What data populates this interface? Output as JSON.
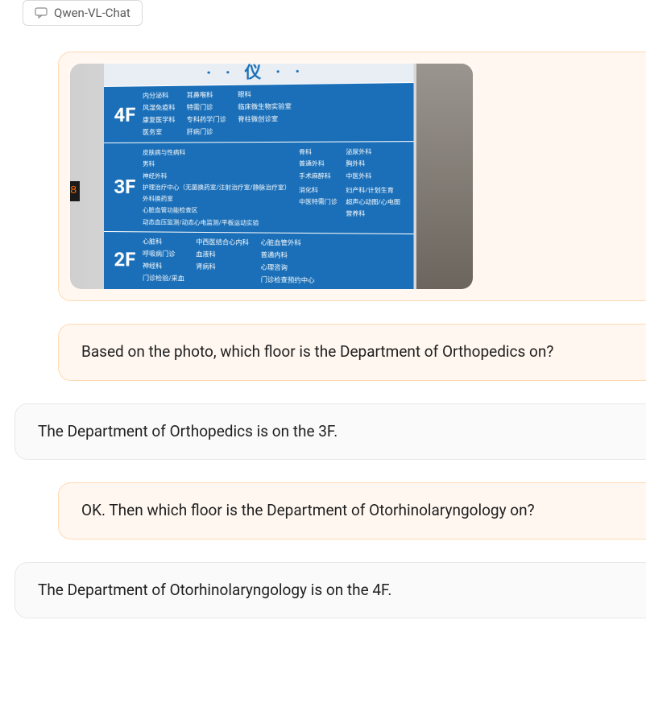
{
  "badge": {
    "label": "Qwen-VL-Chat"
  },
  "messages": {
    "user1": "Based on the photo, which floor is the Department of Orthopedics on?",
    "assistant1": "The Department of Orthopedics is on the 3F.",
    "user2": "OK. Then which floor is the Department of Otorhinolaryngology on?",
    "assistant2": "The Department of Otorhinolaryngology is on the 4F."
  },
  "sign": {
    "elevator_number": "8",
    "floors": {
      "f4": {
        "label": "4F",
        "col1": [
          "内分泌科",
          "风湿免疫科",
          "康复医学科",
          "医务室"
        ],
        "col2": [
          "耳鼻喉科",
          "特需门诊",
          "专科药学门诊",
          "肝病门诊"
        ],
        "col3": [
          "眼科",
          "临床微生物实验室",
          "脊柱微创诊室"
        ]
      },
      "f3": {
        "label": "3F",
        "col1": [
          "皮肤病与性病科",
          "男科",
          "神经外科",
          "护理治疗中心（无菌换药室/注射治疗室/静脉治疗室）",
          "外科换药室",
          "心脏血管功能检查区",
          "动态血压监测/动态心电监测/平板运动实验"
        ],
        "col2": [
          "骨科",
          "普通外科",
          "手术麻醉科",
          "",
          "消化科",
          "中医特需门诊"
        ],
        "col3": [
          "泌尿外科",
          "胸外科",
          "中医外科",
          "",
          "妇产科/计划生育",
          "超声心动图/心电图",
          "营养科"
        ]
      },
      "f2": {
        "label": "2F",
        "col1": [
          "心脏科",
          "呼吸病门诊",
          "神经科",
          "门诊检验/采血"
        ],
        "col2": [
          "中西医结合心内科",
          "血液科",
          "肾病科"
        ],
        "col3": [
          "心脏血管外科",
          "普通内科",
          "心理咨询",
          "门诊检查预约中心"
        ]
      }
    }
  }
}
